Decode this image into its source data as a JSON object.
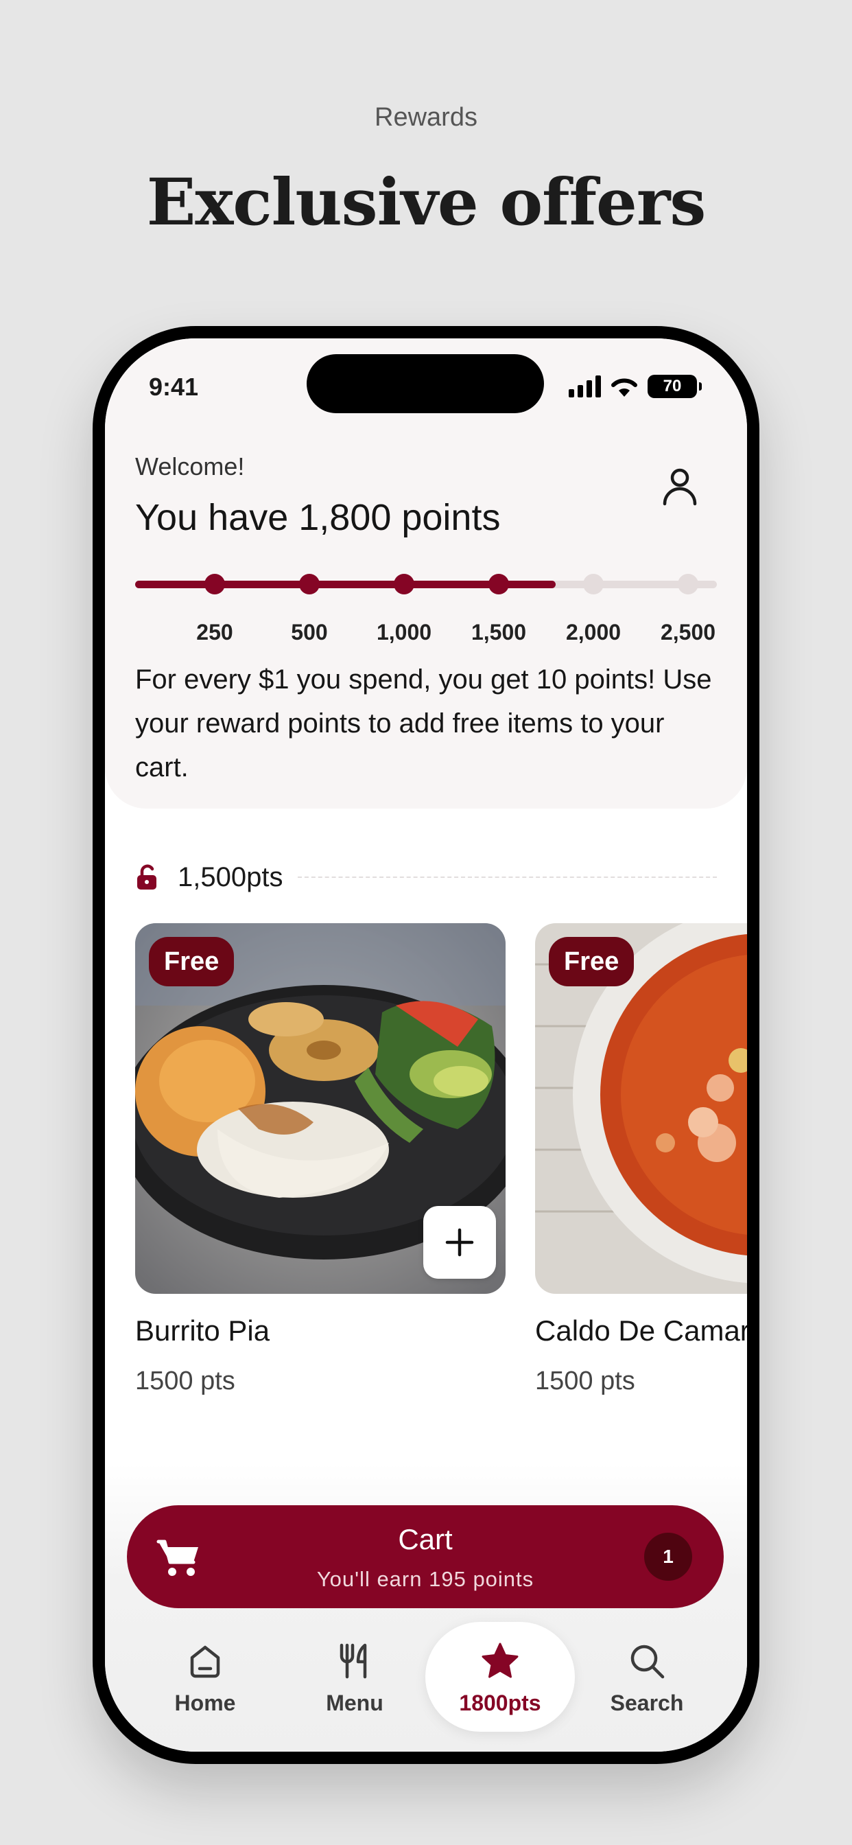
{
  "promo": {
    "label": "Rewards",
    "title": "Exclusive offers"
  },
  "status_bar": {
    "time": "9:41",
    "battery": "70"
  },
  "header": {
    "welcome": "Welcome!",
    "points_heading": "You have 1,800 points",
    "profile_icon": "person-icon"
  },
  "progress": {
    "current_points": 1800,
    "max_points": 2500,
    "milestones": [
      {
        "label": "250",
        "reached": true
      },
      {
        "label": "500",
        "reached": true
      },
      {
        "label": "1,000",
        "reached": true
      },
      {
        "label": "1,500",
        "reached": true
      },
      {
        "label": "2,000",
        "reached": false
      },
      {
        "label": "2,500",
        "reached": false
      }
    ],
    "colors": {
      "filled": "#850525",
      "empty": "#e4dcdc"
    }
  },
  "info": {
    "text": "For every $1 you spend, you get 10 points! Use your reward points to add free items to your cart."
  },
  "tier": {
    "icon": "unlocked-lock-icon",
    "label": "1,500pts"
  },
  "items": [
    {
      "badge": "Free",
      "name": "Burrito Pia",
      "price": "1500 pts",
      "image": "burrito-plate-photo"
    },
    {
      "badge": "Free",
      "name": "Caldo De Camarones",
      "price": "1500 pts",
      "image": "shrimp-soup-photo"
    }
  ],
  "cart": {
    "title": "Cart",
    "subtitle": "You'll earn 195 points",
    "count": "1",
    "icon": "cart-icon",
    "color": "#850525"
  },
  "tabs": [
    {
      "label": "Home",
      "icon": "home-icon",
      "active": false
    },
    {
      "label": "Menu",
      "icon": "fork-knife-icon",
      "active": false
    },
    {
      "label": "1800pts",
      "icon": "star-icon",
      "active": true
    },
    {
      "label": "Search",
      "icon": "search-icon",
      "active": false
    }
  ]
}
